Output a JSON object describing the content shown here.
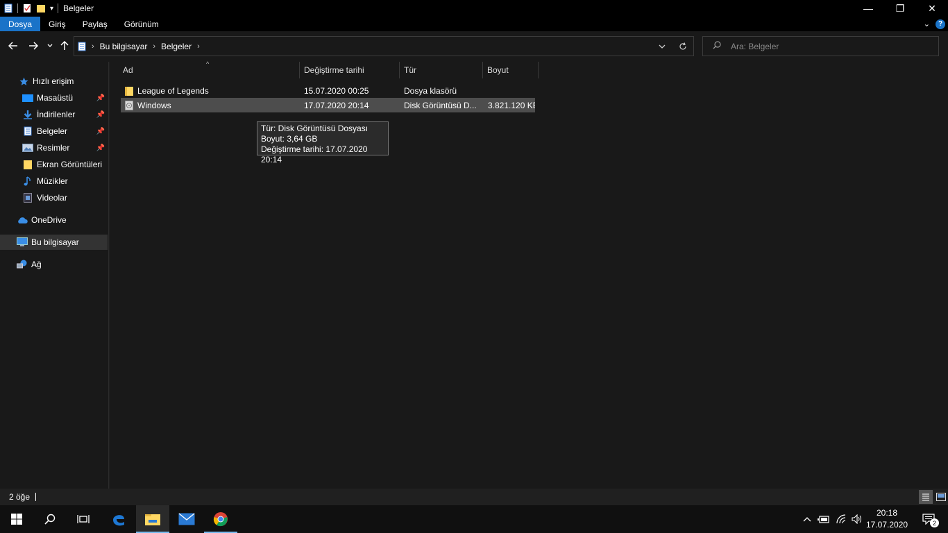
{
  "window": {
    "title": "Belgeler",
    "controls": {
      "minimize": "—",
      "restore": "❐",
      "close": "✕"
    }
  },
  "ribbon": {
    "tabs": [
      {
        "label": "Dosya",
        "active": true
      },
      {
        "label": "Giriş"
      },
      {
        "label": "Paylaş"
      },
      {
        "label": "Görünüm"
      }
    ],
    "help": "?"
  },
  "address": {
    "breadcrumbs": [
      "Bu bilgisayar",
      "Belgeler"
    ]
  },
  "search": {
    "placeholder": "Ara: Belgeler"
  },
  "sidebar": {
    "items": [
      {
        "label": "Hızlı erişim",
        "icon": "star-icon"
      },
      {
        "label": "Masaüstü",
        "icon": "desktop-icon",
        "pinned": true
      },
      {
        "label": "İndirilenler",
        "icon": "download-icon",
        "pinned": true
      },
      {
        "label": "Belgeler",
        "icon": "documents-icon",
        "pinned": true
      },
      {
        "label": "Resimler",
        "icon": "pictures-icon",
        "pinned": true
      },
      {
        "label": "Ekran Görüntüleri",
        "icon": "folder-icon"
      },
      {
        "label": "Müzikler",
        "icon": "music-icon"
      },
      {
        "label": "Videolar",
        "icon": "videos-icon"
      },
      {
        "label": "OneDrive",
        "icon": "cloud-icon"
      },
      {
        "label": "Bu bilgisayar",
        "icon": "computer-icon",
        "selected": true
      },
      {
        "label": "Ağ",
        "icon": "network-icon"
      }
    ]
  },
  "columns": {
    "name": "Ad",
    "date": "Değiştirme tarihi",
    "type": "Tür",
    "size": "Boyut"
  },
  "files": [
    {
      "name": "League of Legends",
      "date": "15.07.2020 00:25",
      "type": "Dosya klasörü",
      "size": "",
      "icon": "folder-icon"
    },
    {
      "name": "Windows",
      "date": "17.07.2020 20:14",
      "type": "Disk Görüntüsü D...",
      "size": "3.821.120 KB",
      "icon": "disk-image-icon",
      "hovered": true
    }
  ],
  "tooltip": {
    "line1": "Tür: Disk Görüntüsü Dosyası",
    "line2": "Boyut: 3,64 GB",
    "line3": "Değiştirme tarihi: 17.07.2020 20:14"
  },
  "status": {
    "count": "2 öğe"
  },
  "taskbar": {
    "time": "20:18",
    "date": "17.07.2020",
    "notifications": "2"
  },
  "colors": {
    "accent": "#1a73c8",
    "background": "#191919",
    "folder": "#ffd763"
  }
}
